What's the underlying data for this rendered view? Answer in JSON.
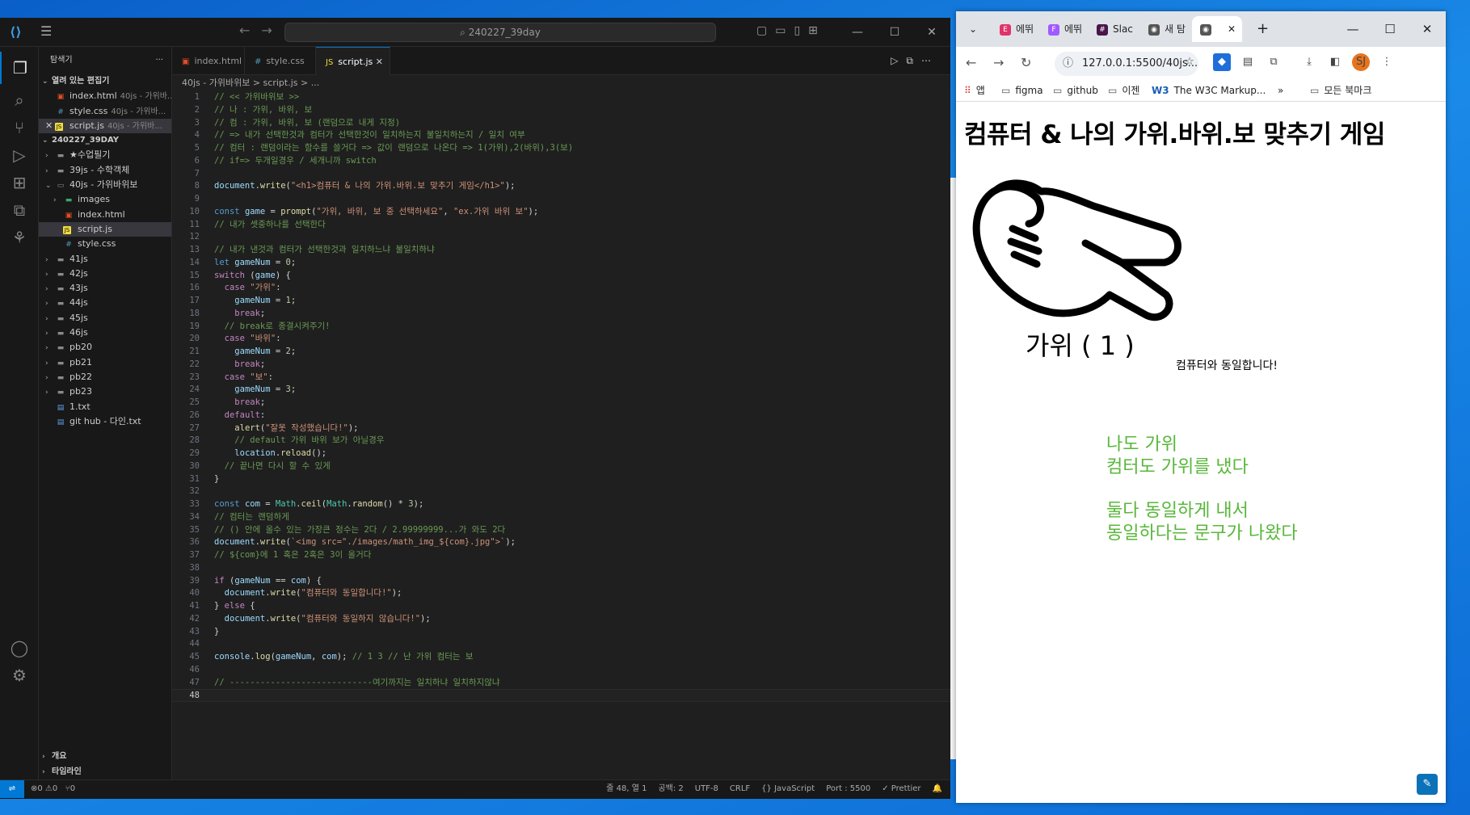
{
  "vscode": {
    "title_search": "240227_39day",
    "explorer_label": "탐색기",
    "open_editors_label": "열려 있는 편집기",
    "open_editors": [
      {
        "name": "index.html",
        "desc": "40js - 가위바...",
        "icon": "html"
      },
      {
        "name": "style.css",
        "desc": "40js - 가위바...",
        "icon": "css"
      },
      {
        "name": "script.js",
        "desc": "40js - 가위바...",
        "icon": "js"
      }
    ],
    "workspace_label": "240227_39DAY",
    "tree": [
      {
        "name": "★수업필기",
        "type": "folder",
        "depth": 1
      },
      {
        "name": "39js - 수학객체",
        "type": "folder",
        "depth": 1
      },
      {
        "name": "40js - 가위바위보",
        "type": "folder-open",
        "depth": 1
      },
      {
        "name": "images",
        "type": "folder",
        "depth": 2
      },
      {
        "name": "index.html",
        "type": "html",
        "depth": 2
      },
      {
        "name": "script.js",
        "type": "js",
        "depth": 2
      },
      {
        "name": "style.css",
        "type": "css",
        "depth": 2
      },
      {
        "name": "41js",
        "type": "folder",
        "depth": 1
      },
      {
        "name": "42js",
        "type": "folder",
        "depth": 1
      },
      {
        "name": "43js",
        "type": "folder",
        "depth": 1
      },
      {
        "name": "44js",
        "type": "folder",
        "depth": 1
      },
      {
        "name": "45js",
        "type": "folder",
        "depth": 1
      },
      {
        "name": "46js",
        "type": "folder",
        "depth": 1
      },
      {
        "name": "pb20",
        "type": "folder",
        "depth": 1
      },
      {
        "name": "pb21",
        "type": "folder",
        "depth": 1
      },
      {
        "name": "pb22",
        "type": "folder",
        "depth": 1
      },
      {
        "name": "pb23",
        "type": "folder",
        "depth": 1
      },
      {
        "name": "1.txt",
        "type": "txt",
        "depth": 1
      },
      {
        "name": "git hub - 다인.txt",
        "type": "txt",
        "depth": 1
      }
    ],
    "outline_label": "개요",
    "timeline_label": "타임라인",
    "tabs": [
      "index.html",
      "style.css",
      "script.js"
    ],
    "breadcrumb": "40js - 가위바위보 > script.js > ...",
    "code_lines": [
      "// << 가위바위보 >>",
      "// 나 : 가위, 바위, 보",
      "// 컴 : 가위, 바위, 보 (랜덤으로 내게 지정)",
      "// => 내가 선택한것과 컴터가 선택한것이 일치하는지 불일치하는지 / 일치 여부",
      "// 컴터 : 랜덤이라는 함수를 쓸거다 => 값이 랜덤으로 나온다 => 1(가위),2(바위),3(보)",
      "// if=> 두개일경우 / 세개니까 switch",
      "",
      "document.write(\"<h1>컴퓨터 & 나의 가위.바위.보 맞추기 게임</h1>\");",
      "",
      "const game = prompt(\"가위, 바위, 보 중 선택하세요\", \"ex.가위 바위 보\");",
      "// 내가 셋중하나를 선택한다",
      "",
      "// 내가 낸것과 컴터가 선택한것과 일치하느냐 불일치하냐",
      "let gameNum = 0;",
      "switch (game) {",
      "  case \"가위\":",
      "    gameNum = 1;",
      "    break;",
      "  // break로 종결시켜주기!",
      "  case \"바위\":",
      "    gameNum = 2;",
      "    break;",
      "  case \"보\":",
      "    gameNum = 3;",
      "    break;",
      "  default:",
      "    alert(\"잘못 작성했습니다!\");",
      "    // default 가위 바위 보가 아닐경우",
      "    location.reload();",
      "  // 끝나면 다시 할 수 있게",
      "}",
      "",
      "const com = Math.ceil(Math.random() * 3);",
      "// 컴터는 랜덤하게",
      "// () 안에 올수 있는 가장큰 정수는 2다 / 2.99999999...가 와도 2다",
      "document.write(`<img src=\"./images/math_img_${com}.jpg\">`);",
      "// ${com}에 1 혹은 2혹은 3이 올거다",
      "",
      "if (gameNum == com) {",
      "  document.write(\"컴퓨터와 동일합니다!\");",
      "} else {",
      "  document.write(\"컴퓨터와 동일하지 않습니다!\");",
      "}",
      "",
      "console.log(gameNum, com); // 1 3 // 난 가위 컴터는 보",
      "",
      "// ----------------------------여기까지는 일치하냐 일치하지않냐",
      ""
    ],
    "status": {
      "problems": "⊗0 ⚠0",
      "ports": "⑂0",
      "position": "줄 48, 열 1",
      "spaces": "공백: 2",
      "encoding": "UTF-8",
      "eol": "CRLF",
      "language": "{} JavaScript",
      "port": "Port : 5500",
      "prettier": "✓ Prettier"
    }
  },
  "chrome": {
    "tabs": [
      {
        "label": "에뛰",
        "fav": "E",
        "color": "#e2336b"
      },
      {
        "label": "에뛰",
        "fav": "F",
        "color": "#a259ff"
      },
      {
        "label": "Slac",
        "fav": "#",
        "color": "#4a154b"
      },
      {
        "label": "새 탐",
        "fav": "◉",
        "color": "#555555"
      },
      {
        "label": "",
        "fav": "◉",
        "color": "#555555"
      }
    ],
    "url": "127.0.0.1:5500/40js...",
    "bookmarks": [
      {
        "label": "앱",
        "icon": "apps-icon"
      },
      {
        "label": "figma",
        "icon": "folder-icon"
      },
      {
        "label": "github",
        "icon": "folder-icon"
      },
      {
        "label": "이젠",
        "icon": "folder-icon"
      },
      {
        "label": "The W3C Markup...",
        "icon": "w3c-icon"
      }
    ],
    "all_bookmarks": "모든 북마크",
    "avatar": "SJ",
    "page": {
      "heading": "컴퓨터 & 나의 가위.바위.보 맞추기 게임",
      "hand_label": "가위 ( 1 )",
      "result": "컴퓨터와 동일합니다!",
      "notes": [
        "나도 가위",
        "컴터도 가위를 냈다",
        "",
        "둘다 동일하게 내서",
        "동일하다는 문구가 나왔다"
      ]
    }
  },
  "colors": {
    "accent": "#0078d4",
    "note_green": "#58b73a"
  }
}
